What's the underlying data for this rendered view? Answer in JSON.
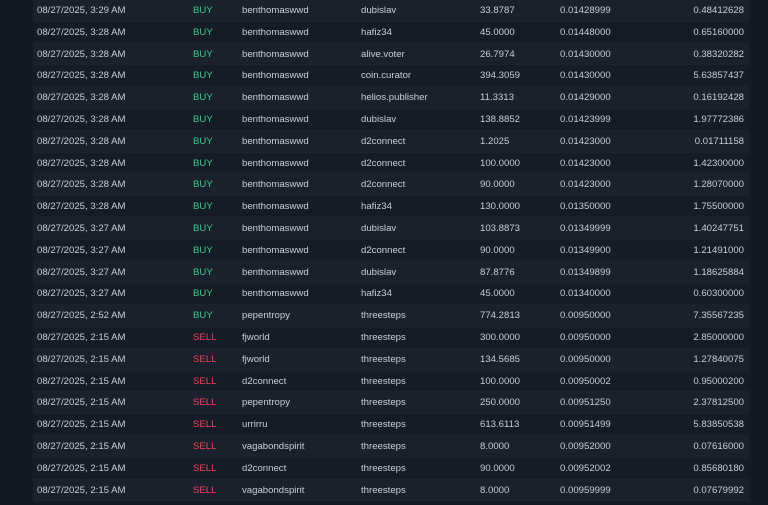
{
  "colors": {
    "buy": "#3fc98a",
    "sell": "#f0445a",
    "text": "#c9ced8",
    "background": "#141a24"
  },
  "trades": [
    {
      "date": "08/27/2025, 3:29 AM",
      "type": "BUY",
      "buyer": "benthomaswwd",
      "seller": "dubislav",
      "amount": "33.8787",
      "price": "0.01428999",
      "total": "0.48412628"
    },
    {
      "date": "08/27/2025, 3:28 AM",
      "type": "BUY",
      "buyer": "benthomaswwd",
      "seller": "hafiz34",
      "amount": "45.0000",
      "price": "0.01448000",
      "total": "0.65160000"
    },
    {
      "date": "08/27/2025, 3:28 AM",
      "type": "BUY",
      "buyer": "benthomaswwd",
      "seller": "alive.voter",
      "amount": "26.7974",
      "price": "0.01430000",
      "total": "0.38320282"
    },
    {
      "date": "08/27/2025, 3:28 AM",
      "type": "BUY",
      "buyer": "benthomaswwd",
      "seller": "coin.curator",
      "amount": "394.3059",
      "price": "0.01430000",
      "total": "5.63857437"
    },
    {
      "date": "08/27/2025, 3:28 AM",
      "type": "BUY",
      "buyer": "benthomaswwd",
      "seller": "helios.publisher",
      "amount": "11.3313",
      "price": "0.01429000",
      "total": "0.16192428"
    },
    {
      "date": "08/27/2025, 3:28 AM",
      "type": "BUY",
      "buyer": "benthomaswwd",
      "seller": "dubislav",
      "amount": "138.8852",
      "price": "0.01423999",
      "total": "1.97772386"
    },
    {
      "date": "08/27/2025, 3:28 AM",
      "type": "BUY",
      "buyer": "benthomaswwd",
      "seller": "d2connect",
      "amount": "1.2025",
      "price": "0.01423000",
      "total": "0.01711158"
    },
    {
      "date": "08/27/2025, 3:28 AM",
      "type": "BUY",
      "buyer": "benthomaswwd",
      "seller": "d2connect",
      "amount": "100.0000",
      "price": "0.01423000",
      "total": "1.42300000"
    },
    {
      "date": "08/27/2025, 3:28 AM",
      "type": "BUY",
      "buyer": "benthomaswwd",
      "seller": "d2connect",
      "amount": "90.0000",
      "price": "0.01423000",
      "total": "1.28070000"
    },
    {
      "date": "08/27/2025, 3:28 AM",
      "type": "BUY",
      "buyer": "benthomaswwd",
      "seller": "hafiz34",
      "amount": "130.0000",
      "price": "0.01350000",
      "total": "1.75500000"
    },
    {
      "date": "08/27/2025, 3:27 AM",
      "type": "BUY",
      "buyer": "benthomaswwd",
      "seller": "dubislav",
      "amount": "103.8873",
      "price": "0.01349999",
      "total": "1.40247751"
    },
    {
      "date": "08/27/2025, 3:27 AM",
      "type": "BUY",
      "buyer": "benthomaswwd",
      "seller": "d2connect",
      "amount": "90.0000",
      "price": "0.01349900",
      "total": "1.21491000"
    },
    {
      "date": "08/27/2025, 3:27 AM",
      "type": "BUY",
      "buyer": "benthomaswwd",
      "seller": "dubislav",
      "amount": "87.8776",
      "price": "0.01349899",
      "total": "1.18625884"
    },
    {
      "date": "08/27/2025, 3:27 AM",
      "type": "BUY",
      "buyer": "benthomaswwd",
      "seller": "hafiz34",
      "amount": "45.0000",
      "price": "0.01340000",
      "total": "0.60300000"
    },
    {
      "date": "08/27/2025, 2:52 AM",
      "type": "BUY",
      "buyer": "pepentropy",
      "seller": "threesteps",
      "amount": "774.2813",
      "price": "0.00950000",
      "total": "7.35567235"
    },
    {
      "date": "08/27/2025, 2:15 AM",
      "type": "SELL",
      "buyer": "fjworld",
      "seller": "threesteps",
      "amount": "300.0000",
      "price": "0.00950000",
      "total": "2.85000000"
    },
    {
      "date": "08/27/2025, 2:15 AM",
      "type": "SELL",
      "buyer": "fjworld",
      "seller": "threesteps",
      "amount": "134.5685",
      "price": "0.00950000",
      "total": "1.27840075"
    },
    {
      "date": "08/27/2025, 2:15 AM",
      "type": "SELL",
      "buyer": "d2connect",
      "seller": "threesteps",
      "amount": "100.0000",
      "price": "0.00950002",
      "total": "0.95000200"
    },
    {
      "date": "08/27/2025, 2:15 AM",
      "type": "SELL",
      "buyer": "pepentropy",
      "seller": "threesteps",
      "amount": "250.0000",
      "price": "0.00951250",
      "total": "2.37812500"
    },
    {
      "date": "08/27/2025, 2:15 AM",
      "type": "SELL",
      "buyer": "urrirru",
      "seller": "threesteps",
      "amount": "613.6113",
      "price": "0.00951499",
      "total": "5.83850538"
    },
    {
      "date": "08/27/2025, 2:15 AM",
      "type": "SELL",
      "buyer": "vagabondspirit",
      "seller": "threesteps",
      "amount": "8.0000",
      "price": "0.00952000",
      "total": "0.07616000"
    },
    {
      "date": "08/27/2025, 2:15 AM",
      "type": "SELL",
      "buyer": "d2connect",
      "seller": "threesteps",
      "amount": "90.0000",
      "price": "0.00952002",
      "total": "0.85680180"
    },
    {
      "date": "08/27/2025, 2:15 AM",
      "type": "SELL",
      "buyer": "vagabondspirit",
      "seller": "threesteps",
      "amount": "8.0000",
      "price": "0.00959999",
      "total": "0.07679992"
    }
  ]
}
